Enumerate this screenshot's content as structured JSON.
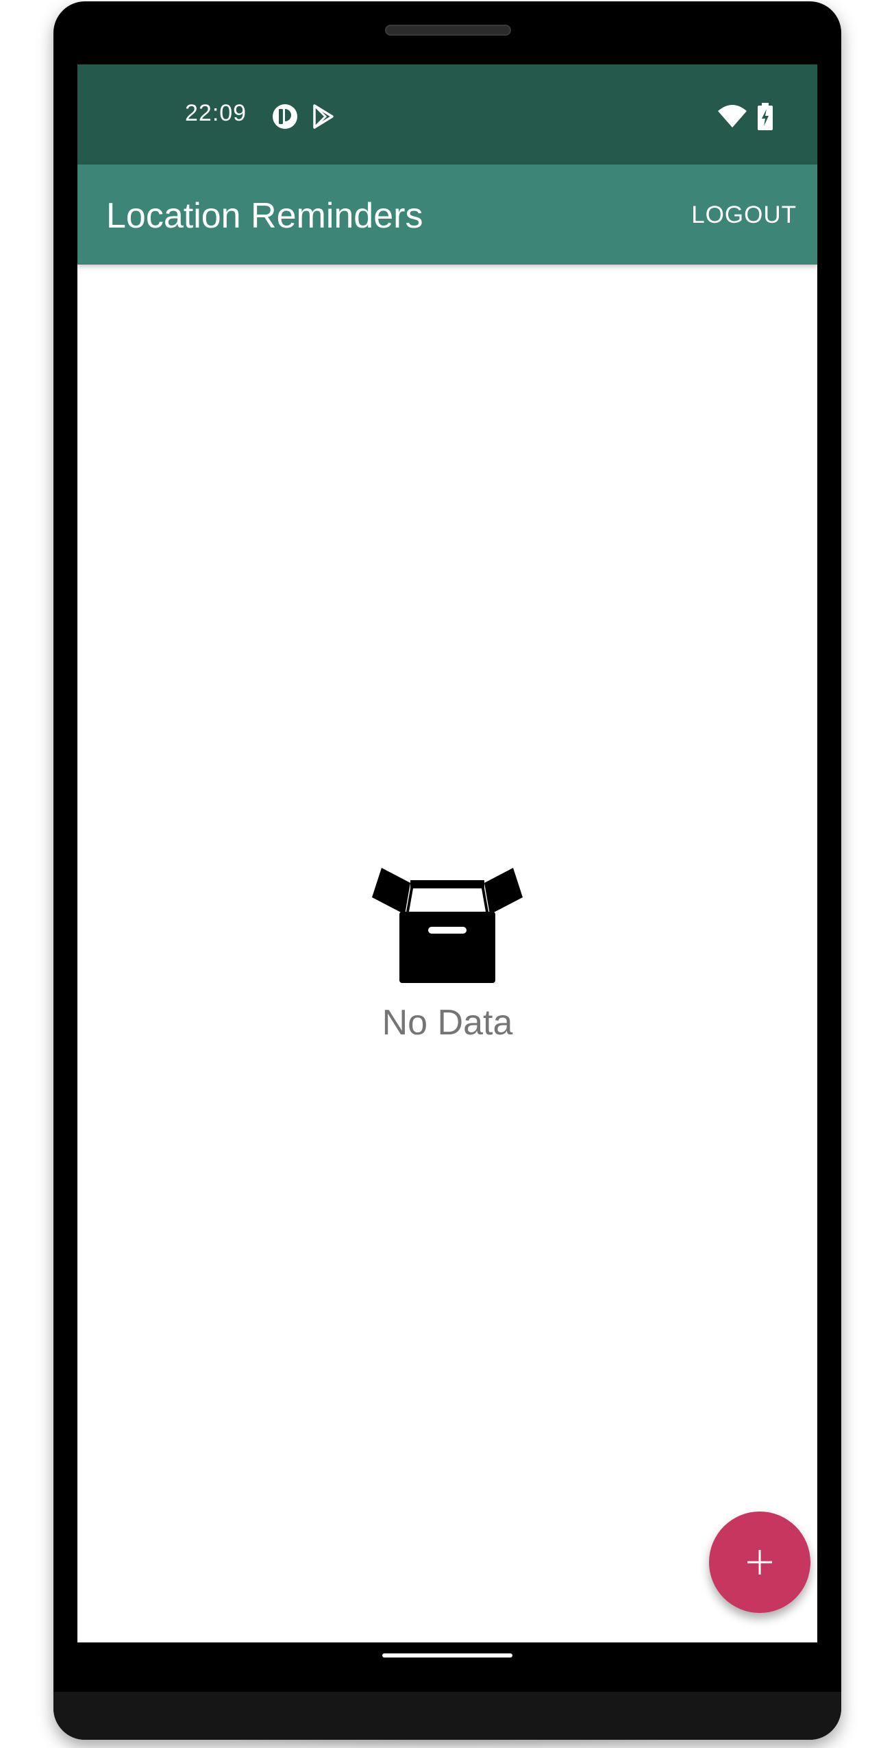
{
  "status_bar": {
    "time": "22:09",
    "left_icons": [
      "notification-icon",
      "play-store-icon"
    ],
    "right_icons": [
      "wifi-icon",
      "battery-charging-icon"
    ],
    "color": "#24594b"
  },
  "app_bar": {
    "title": "Location Reminders",
    "logout_label": "LOGOUT",
    "color": "#3c8577"
  },
  "empty_state": {
    "icon": "empty-box-icon",
    "text": "No Data"
  },
  "fab": {
    "icon": "add-icon",
    "color": "#c6365f"
  }
}
